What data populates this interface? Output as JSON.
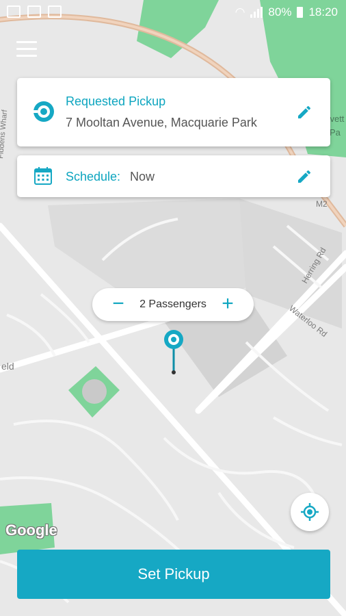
{
  "status_bar": {
    "battery": "80%",
    "time": "18:20"
  },
  "pickup_card": {
    "title": "Requested Pickup",
    "address": "7 Mooltan Avenue, Macquarie Park"
  },
  "schedule_card": {
    "label": "Schedule:",
    "value": "Now"
  },
  "passengers": {
    "label": "2 Passengers",
    "minus": "−",
    "plus": "+"
  },
  "map_labels": {
    "m2": "M2",
    "road1": "Herring Rd",
    "road2": "Waterloo Rd",
    "road3": "Fiddens Wharf",
    "place1": "eld",
    "place2": "Lovett",
    "place3": "Pa"
  },
  "google_logo": "Google",
  "set_pickup_button": "Set Pickup",
  "colors": {
    "accent": "#16a8c4",
    "park": "#7fd49a",
    "highway": "#e0b99c"
  }
}
